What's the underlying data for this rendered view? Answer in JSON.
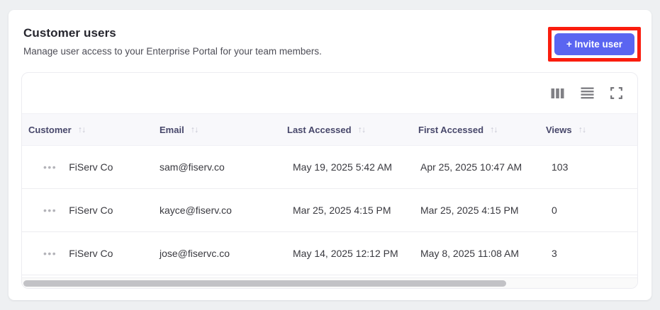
{
  "page": {
    "title": "Customer users",
    "subtitle": "Manage user access to your Enterprise Portal for your team members."
  },
  "header": {
    "invite_button_label": "+ Invite user"
  },
  "toolbar": {
    "icons": [
      "columns-icon",
      "rows-icon",
      "expand-icon"
    ]
  },
  "table": {
    "sort_icon": "↑↓",
    "row_menu_icon": "•••",
    "columns": [
      {
        "label": "Customer"
      },
      {
        "label": "Email"
      },
      {
        "label": "Last Accessed"
      },
      {
        "label": "First Accessed"
      },
      {
        "label": "Views"
      }
    ],
    "rows": [
      {
        "customer": "FiServ Co",
        "email": "sam@fiserv.co",
        "last_accessed": "May 19, 2025 5:42 AM",
        "first_accessed": "Apr 25, 2025 10:47 AM",
        "views": "103"
      },
      {
        "customer": "FiServ Co",
        "email": "kayce@fiserv.co",
        "last_accessed": "Mar 25, 2025 4:15 PM",
        "first_accessed": "Mar 25, 2025 4:15 PM",
        "views": "0"
      },
      {
        "customer": "FiServ Co",
        "email": "jose@fiservc.co",
        "last_accessed": "May 14, 2025 12:12 PM",
        "first_accessed": "May 8, 2025 11:08 AM",
        "views": "3"
      }
    ]
  },
  "colors": {
    "accent": "#5a65f1",
    "highlight_red": "#fa1d0e",
    "table_header_bg": "#f8f8fb",
    "page_bg": "#eef0f2"
  }
}
